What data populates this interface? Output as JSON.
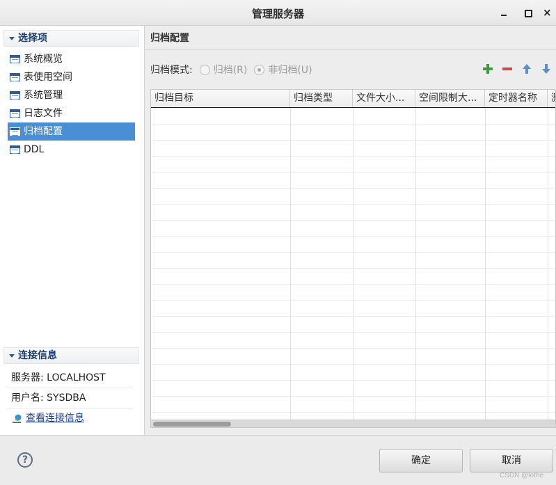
{
  "window": {
    "title": "管理服务器",
    "close_glyph": "×"
  },
  "sidebar": {
    "section_title": "选择项",
    "items": [
      {
        "label": "系统概览",
        "icon": "table-icon"
      },
      {
        "label": "表使用空间",
        "icon": "table-icon"
      },
      {
        "label": "系统管理",
        "icon": "table-icon"
      },
      {
        "label": "日志文件",
        "icon": "table-icon"
      },
      {
        "label": "归档配置",
        "icon": "table-icon",
        "selected": true
      },
      {
        "label": "DDL",
        "icon": "table-icon"
      }
    ]
  },
  "connection": {
    "section_title": "连接信息",
    "server": "服务器: LOCALHOST",
    "user": "用户名: SYSDBA",
    "link_label": "查看连接信息"
  },
  "main": {
    "title": "归档配置",
    "mode_label": "归档模式:",
    "options": [
      {
        "label": "归档(R)",
        "checked": false
      },
      {
        "label": "非归档(U)",
        "checked": true
      }
    ],
    "toolbar": [
      "add-icon",
      "remove-icon",
      "move-up-icon",
      "move-down-icon"
    ],
    "columns": [
      "归档目标",
      "归档类型",
      "文件大小...",
      "空间限制大...",
      "定时器名称",
      "激"
    ]
  },
  "footer": {
    "ok_label": "确定",
    "cancel_label": "取消",
    "help_glyph": "?",
    "watermark": "CSDN @lothe"
  },
  "colors": {
    "selection": "#4a8fd6",
    "section_title": "#1b3e6f",
    "link": "#1a3f95"
  }
}
